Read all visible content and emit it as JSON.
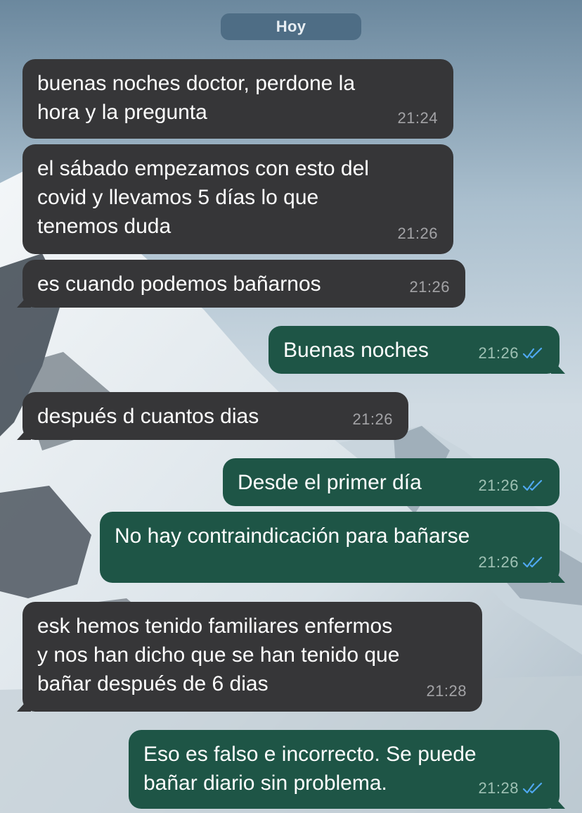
{
  "date_label": "Hoy",
  "messages": [
    {
      "direction": "in",
      "text": "buenas noches doctor, perdone la\nhora y la pregunta",
      "time": "21:24"
    },
    {
      "direction": "in",
      "text": "el sábado empezamos con esto del\ncovid y llevamos 5 días lo que\ntenemos duda",
      "time": "21:26"
    },
    {
      "direction": "in",
      "text": "es cuando podemos bañarnos",
      "time": "21:26"
    },
    {
      "direction": "out",
      "text": "Buenas noches",
      "time": "21:26",
      "status": "read"
    },
    {
      "direction": "in",
      "text": "después d cuantos dias",
      "time": "21:26"
    },
    {
      "direction": "out",
      "text": "Desde el primer día",
      "time": "21:26",
      "status": "read"
    },
    {
      "direction": "out",
      "text": "No hay contraindicación para bañarse",
      "time": "21:26",
      "status": "read"
    },
    {
      "direction": "in",
      "text": "esk hemos tenido familiares enfermos\ny nos han dicho que se han tenido que\nbañar después de 6 dias",
      "time": "21:28"
    },
    {
      "direction": "out",
      "text": "Eso es falso e incorrecto. Se puede\nbañar diario sin problema.",
      "time": "21:28",
      "status": "read"
    }
  ],
  "colors": {
    "incoming_bubble": "#363638",
    "outgoing_bubble": "#1e5546",
    "read_ticks": "#4fa8f0",
    "date_pill": "#4e6d85"
  },
  "icons": {
    "read_status": "double-check-icon"
  }
}
